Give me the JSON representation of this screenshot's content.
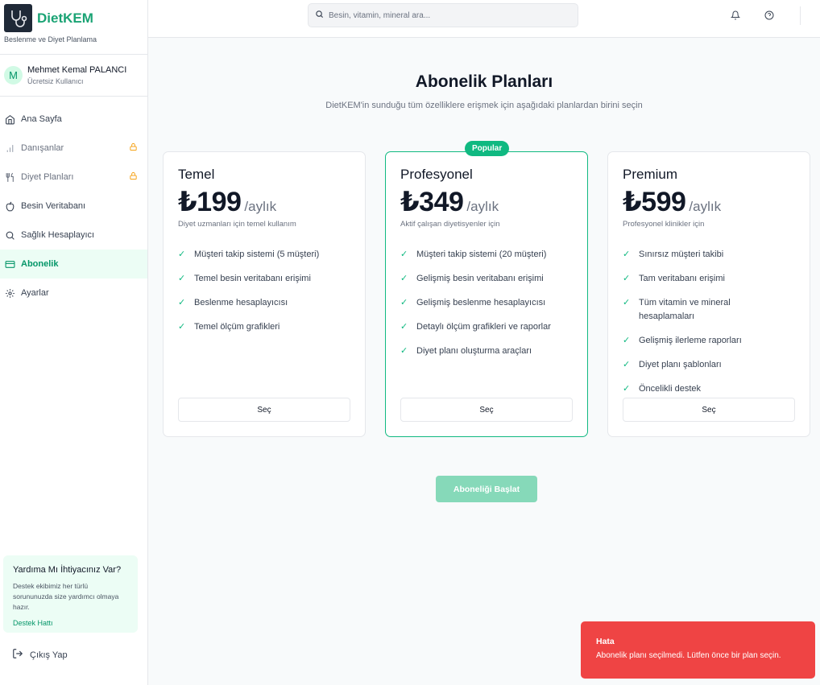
{
  "brand": {
    "name": "DietKEM",
    "subtitle": "Beslenme ve Diyet Planlama"
  },
  "user": {
    "initial": "M",
    "name": "Mehmet Kemal PALANCI",
    "role": "Ücretsiz Kullanıcı"
  },
  "sidebar": {
    "items": [
      {
        "label": "Ana Sayfa",
        "icon": "home-icon",
        "locked": false
      },
      {
        "label": "Danışanlar",
        "icon": "bar-chart-icon",
        "locked": true
      },
      {
        "label": "Diyet Planları",
        "icon": "utensils-icon",
        "locked": true
      },
      {
        "label": "Besin Veritabanı",
        "icon": "apple-icon",
        "locked": false
      },
      {
        "label": "Sağlık Hesaplayıcı",
        "icon": "search-icon",
        "locked": false
      },
      {
        "label": "Abonelik",
        "icon": "credit-card-icon",
        "locked": false,
        "active": true
      },
      {
        "label": "Ayarlar",
        "icon": "gear-icon",
        "locked": false
      }
    ],
    "help": {
      "title": "Yardıma Mı İhtiyacınız Var?",
      "text": "Destek ekibimiz her türlü sorununuzda size yardımcı olmaya hazır.",
      "link": "Destek Hattı"
    },
    "logout": "Çıkış Yap"
  },
  "topbar": {
    "search_placeholder": "Besin, vitamin, mineral ara..."
  },
  "main": {
    "title": "Abonelik Planları",
    "subtitle": "DietKEM'in sunduğu tüm özelliklere erişmek için aşağıdaki planlardan birini seçin",
    "plans": [
      {
        "name": "Temel",
        "price": "₺199",
        "period": "/aylık",
        "desc": "Diyet uzmanları için temel kullanım",
        "features": [
          "Müşteri takip sistemi (5 müşteri)",
          "Temel besin veritabanı erişimi",
          "Beslenme hesaplayıcısı",
          "Temel ölçüm grafikleri"
        ],
        "button": "Seç"
      },
      {
        "name": "Profesyonel",
        "price": "₺349",
        "period": "/aylık",
        "desc": "Aktif çalışan diyetisyenler için",
        "badge": "Popular",
        "features": [
          "Müşteri takip sistemi (20 müşteri)",
          "Gelişmiş besin veritabanı erişimi",
          "Gelişmiş beslenme hesaplayıcısı",
          "Detaylı ölçüm grafikleri ve raporlar",
          "Diyet planı oluşturma araçları"
        ],
        "button": "Seç"
      },
      {
        "name": "Premium",
        "price": "₺599",
        "period": "/aylık",
        "desc": "Profesyonel klinikler için",
        "features": [
          "Sınırsız müşteri takibi",
          "Tam veritabanı erişimi",
          "Tüm vitamin ve mineral hesaplamaları",
          "Gelişmiş ilerleme raporları",
          "Diyet planı şablonları",
          "Öncelikli destek"
        ],
        "button": "Seç"
      }
    ],
    "start_button": "Aboneliği Başlat"
  },
  "toast": {
    "title": "Hata",
    "message": "Abonelik planı seçilmedi. Lütfen önce bir plan seçin."
  },
  "colors": {
    "accent": "#10b981",
    "error": "#ef4444"
  }
}
